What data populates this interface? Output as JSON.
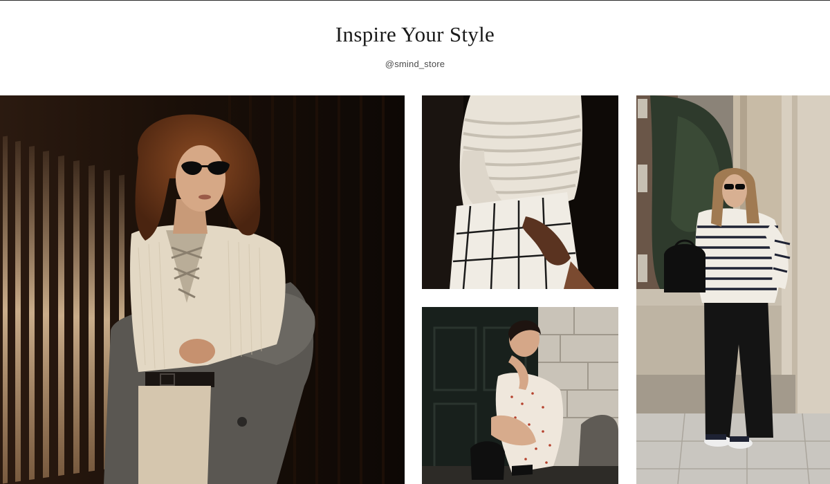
{
  "header": {
    "title": "Inspire Your Style",
    "handle": "@smind_store"
  },
  "gallery": {
    "images": [
      {
        "name": "woman-curly-hair-lace-up-sweater-photo"
      },
      {
        "name": "striped-light-sweater-plaid-skirt-photo"
      },
      {
        "name": "woman-crouching-polka-dot-dress-photo"
      },
      {
        "name": "woman-striped-sweater-black-trousers-photo"
      }
    ]
  }
}
